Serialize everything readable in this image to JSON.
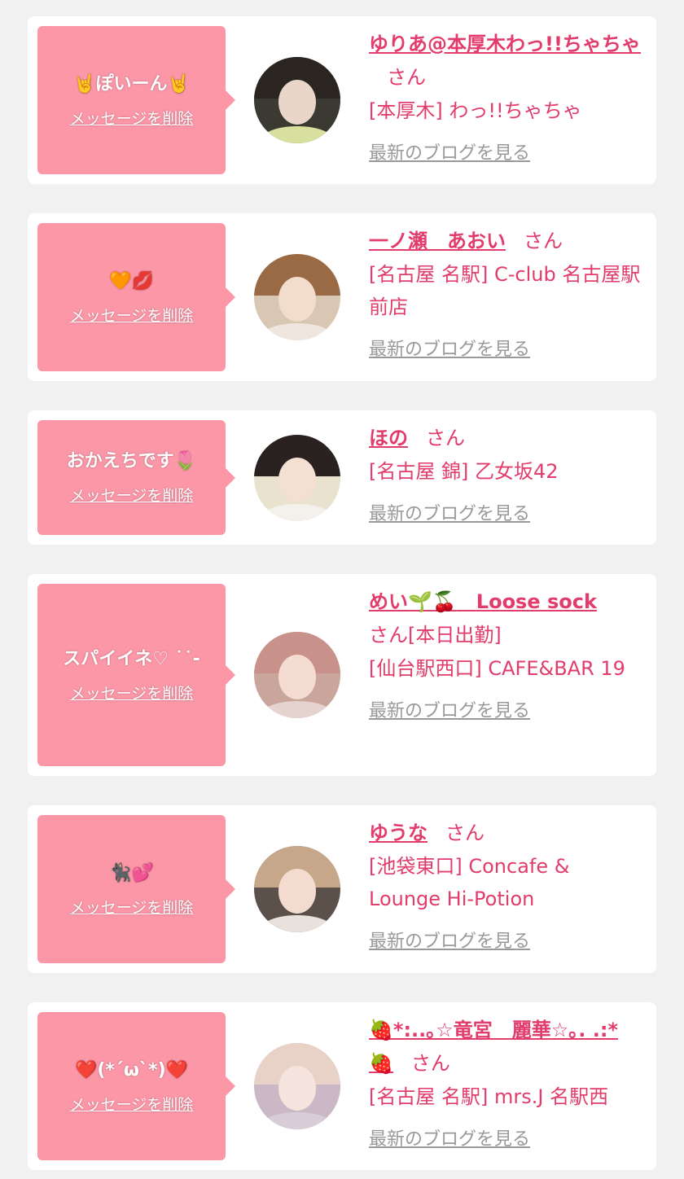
{
  "delete_label": "メッセージを削除",
  "blog_label": "最新のブログを見る",
  "san_label": "さん",
  "items": [
    {
      "message": "ぽいーん",
      "name": "ゆりあ@本厚木わっ!!ちゃちゃ",
      "shop": "[本厚木] わっ!!ちゃちゃ",
      "avatar_colors": {
        "bg": "#3a3a32",
        "hair": "#2b2522",
        "face": "#e9d6c8",
        "body": "#d8e0a0"
      }
    },
    {
      "message": "🧡💋",
      "name": "一ノ瀬　あおい",
      "shop": "[名古屋 名駅] C-club 名古屋駅前店",
      "avatar_colors": {
        "bg": "#d8c7b2",
        "hair": "#9a6a45",
        "face": "#f2dccb",
        "body": "#efe6df"
      }
    },
    {
      "message": "おかえちです",
      "name": "ほの",
      "shop": "[名古屋 錦] 乙女坂42",
      "avatar_colors": {
        "bg": "#e9e2cf",
        "hair": "#2a2220",
        "face": "#f3e0d3",
        "body": "#f4f1ec"
      }
    },
    {
      "message": "スパイイネ♡ ˙˙-",
      "name_main": "めい",
      "name_tail": "Loose sock",
      "name_suffix": "[本日出勤]",
      "shop": "[仙台駅西口] CAFE&BAR 19",
      "avatar_colors": {
        "bg": "#c9a59c",
        "hair": "#c8928a",
        "face": "#f4dcd2",
        "body": "#e5d3cf"
      }
    },
    {
      "message": "🐈‍⬛💕",
      "name": "ゆうな",
      "shop": "[池袋東口] Concafe & Lounge Hi-Potion",
      "avatar_colors": {
        "bg": "#5b514a",
        "hair": "#c7a78a",
        "face": "#f3dccf",
        "body": "#e9e2dc"
      }
    },
    {
      "message": "❤️(*´ω`*)❤️",
      "name_line1": "*:..｡☆竜宮　麗華☆｡. .:*",
      "shop": "[名古屋 名駅] mrs.J 名駅西",
      "avatar_colors": {
        "bg": "#cbb8c6",
        "hair": "#e8d2c8",
        "face": "#f5e4de",
        "body": "#d8cdd6"
      }
    }
  ]
}
